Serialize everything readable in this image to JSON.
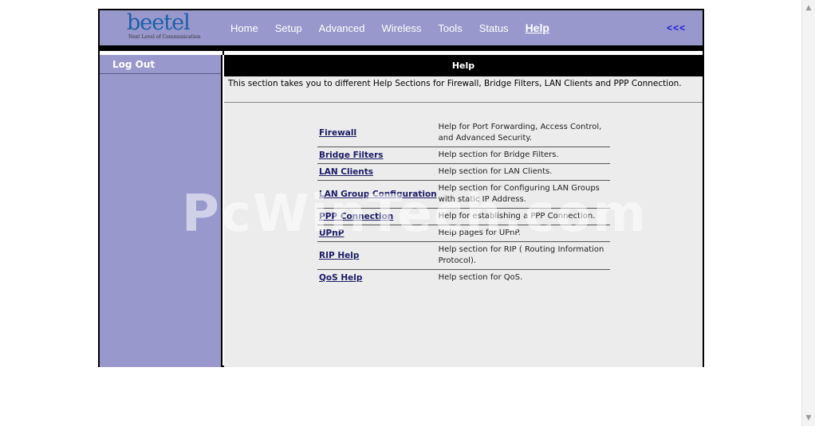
{
  "brand": {
    "logo": "beetel",
    "tagline": "Next Level of Communication"
  },
  "nav": {
    "items": [
      {
        "label": "Home"
      },
      {
        "label": "Setup"
      },
      {
        "label": "Advanced"
      },
      {
        "label": "Wireless"
      },
      {
        "label": "Tools"
      },
      {
        "label": "Status"
      },
      {
        "label": "Help"
      }
    ],
    "back": "<<<"
  },
  "sidebar": {
    "items": [
      {
        "label": "Log Out"
      }
    ]
  },
  "content": {
    "title": "Help",
    "description": "This section takes you to different Help Sections for Firewall, Bridge Filters, LAN Clients and PPP Connection.",
    "rows": [
      {
        "link": "Firewall",
        "text": "Help for Port Forwarding, Access Control, and Advanced Security."
      },
      {
        "link": "Bridge Filters",
        "text": "Help section for Bridge Filters."
      },
      {
        "link": "LAN Clients",
        "text": "Help section for LAN Clients."
      },
      {
        "link": "LAN Group Configuration",
        "text": "Help section for Configuring LAN Groups with static IP Address."
      },
      {
        "link": "PPP Connection",
        "text": "Help for establishing a PPP Connection."
      },
      {
        "link": "UPnP",
        "text": "Help pages for UPnP."
      },
      {
        "link": "RIP Help",
        "text": "Help section for RIP ( Routing Information Protocol)."
      },
      {
        "link": "QoS Help",
        "text": "Help section for QoS."
      }
    ]
  },
  "watermark": "PcWinTech.com",
  "colors": {
    "header_bg": "#9898cc",
    "link": "#1a1a66",
    "back_link": "#1a1adb"
  }
}
